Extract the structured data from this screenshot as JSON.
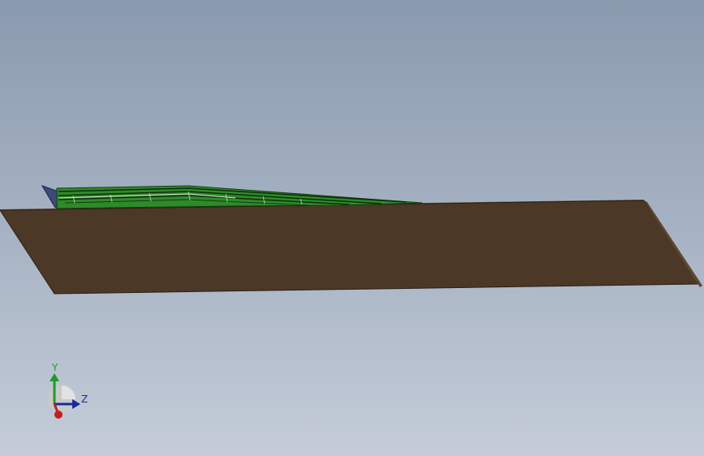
{
  "viewport": {
    "background_top": "#8a9aae",
    "background_bottom": "#c4ccd8"
  },
  "model": {
    "plate_color": "#4b3827",
    "plate_edge_color": "#6b5440",
    "ramp_color": "#2f8a2a",
    "ramp_dark_color": "#1c5a18",
    "wedge_color": "#3e4a78"
  },
  "triad": {
    "x_axis": {
      "label": "",
      "color": "#c0201b"
    },
    "y_axis": {
      "label": "Y",
      "color": "#1f9a2a"
    },
    "z_axis": {
      "label": "Z",
      "color": "#1a2a9a"
    }
  }
}
